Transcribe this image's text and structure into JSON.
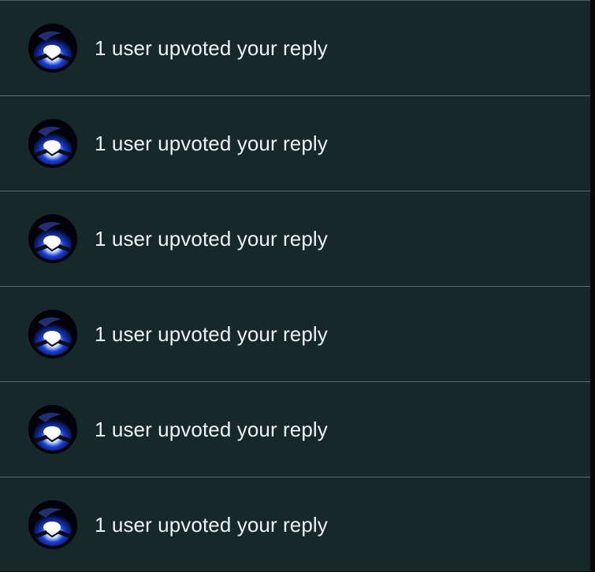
{
  "notifications": [
    {
      "text": "1 user upvoted your reply",
      "avatar_icon": "user-avatar-icon"
    },
    {
      "text": "1 user upvoted your reply",
      "avatar_icon": "user-avatar-icon"
    },
    {
      "text": "1 user upvoted your reply",
      "avatar_icon": "user-avatar-icon"
    },
    {
      "text": "1 user upvoted your reply",
      "avatar_icon": "user-avatar-icon"
    },
    {
      "text": "1 user upvoted your reply",
      "avatar_icon": "user-avatar-icon"
    },
    {
      "text": "1 user upvoted your reply",
      "avatar_icon": "user-avatar-icon"
    }
  ],
  "colors": {
    "background": "#17282a",
    "divider": "#5d6b6d",
    "text": "#eef3f3",
    "avatar_blue": "#1a3fd8"
  }
}
